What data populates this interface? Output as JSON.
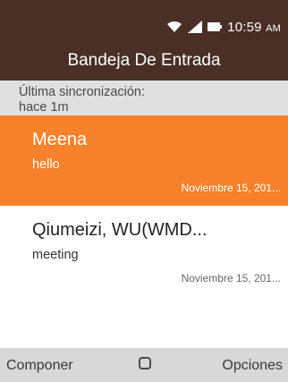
{
  "status_bar": {
    "icons": [
      "wifi-icon",
      "signal-icon",
      "battery-icon"
    ],
    "time": "10:59",
    "ampm": "AM"
  },
  "header": {
    "title": "Bandeja De Entrada"
  },
  "sync": {
    "line1": "Última sincronización:",
    "line2": "hace 1m"
  },
  "messages": [
    {
      "sender": "Meena",
      "subject": "hello",
      "date": "Noviembre 15, 201...",
      "selected": true
    },
    {
      "sender": "Qiumeizi, WU(WMD...",
      "subject": "meeting",
      "date": "Noviembre 15, 201...",
      "selected": false
    }
  ],
  "softkeys": {
    "left": "Componer",
    "center_icon": "select-square-icon",
    "right": "Opciones"
  },
  "colors": {
    "header_bg": "#4a2f26",
    "selected_bg": "#f7822b",
    "sync_bg": "#e0e0e0",
    "softkey_bg": "#d8d8d8"
  }
}
